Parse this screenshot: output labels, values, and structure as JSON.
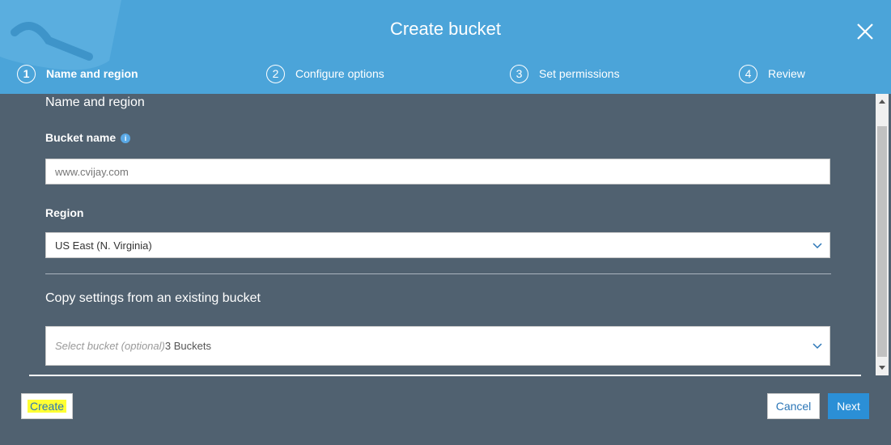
{
  "dialog": {
    "title": "Create bucket"
  },
  "steps": [
    {
      "num": "1",
      "label": "Name and region"
    },
    {
      "num": "2",
      "label": "Configure options"
    },
    {
      "num": "3",
      "label": "Set permissions"
    },
    {
      "num": "4",
      "label": "Review"
    }
  ],
  "form": {
    "section_title": "Name and region",
    "bucket_name": {
      "label": "Bucket name",
      "placeholder": "www.cvijay.com"
    },
    "region": {
      "label": "Region",
      "value": "US East (N. Virginia)"
    },
    "copy_settings": {
      "title": "Copy settings from an existing bucket",
      "placeholder": "Select bucket (optional)",
      "count": "3 Buckets"
    }
  },
  "footer": {
    "create_label": "Create",
    "cancel_label": "Cancel",
    "next_label": "Next"
  },
  "colors": {
    "header": "#4ba4d9",
    "body": "#506170",
    "primary": "#2b8fd6",
    "highlight": "#ffff33"
  },
  "icons": {
    "close": "close-icon",
    "info": "info-icon",
    "chevron": "chevron-down-icon"
  }
}
